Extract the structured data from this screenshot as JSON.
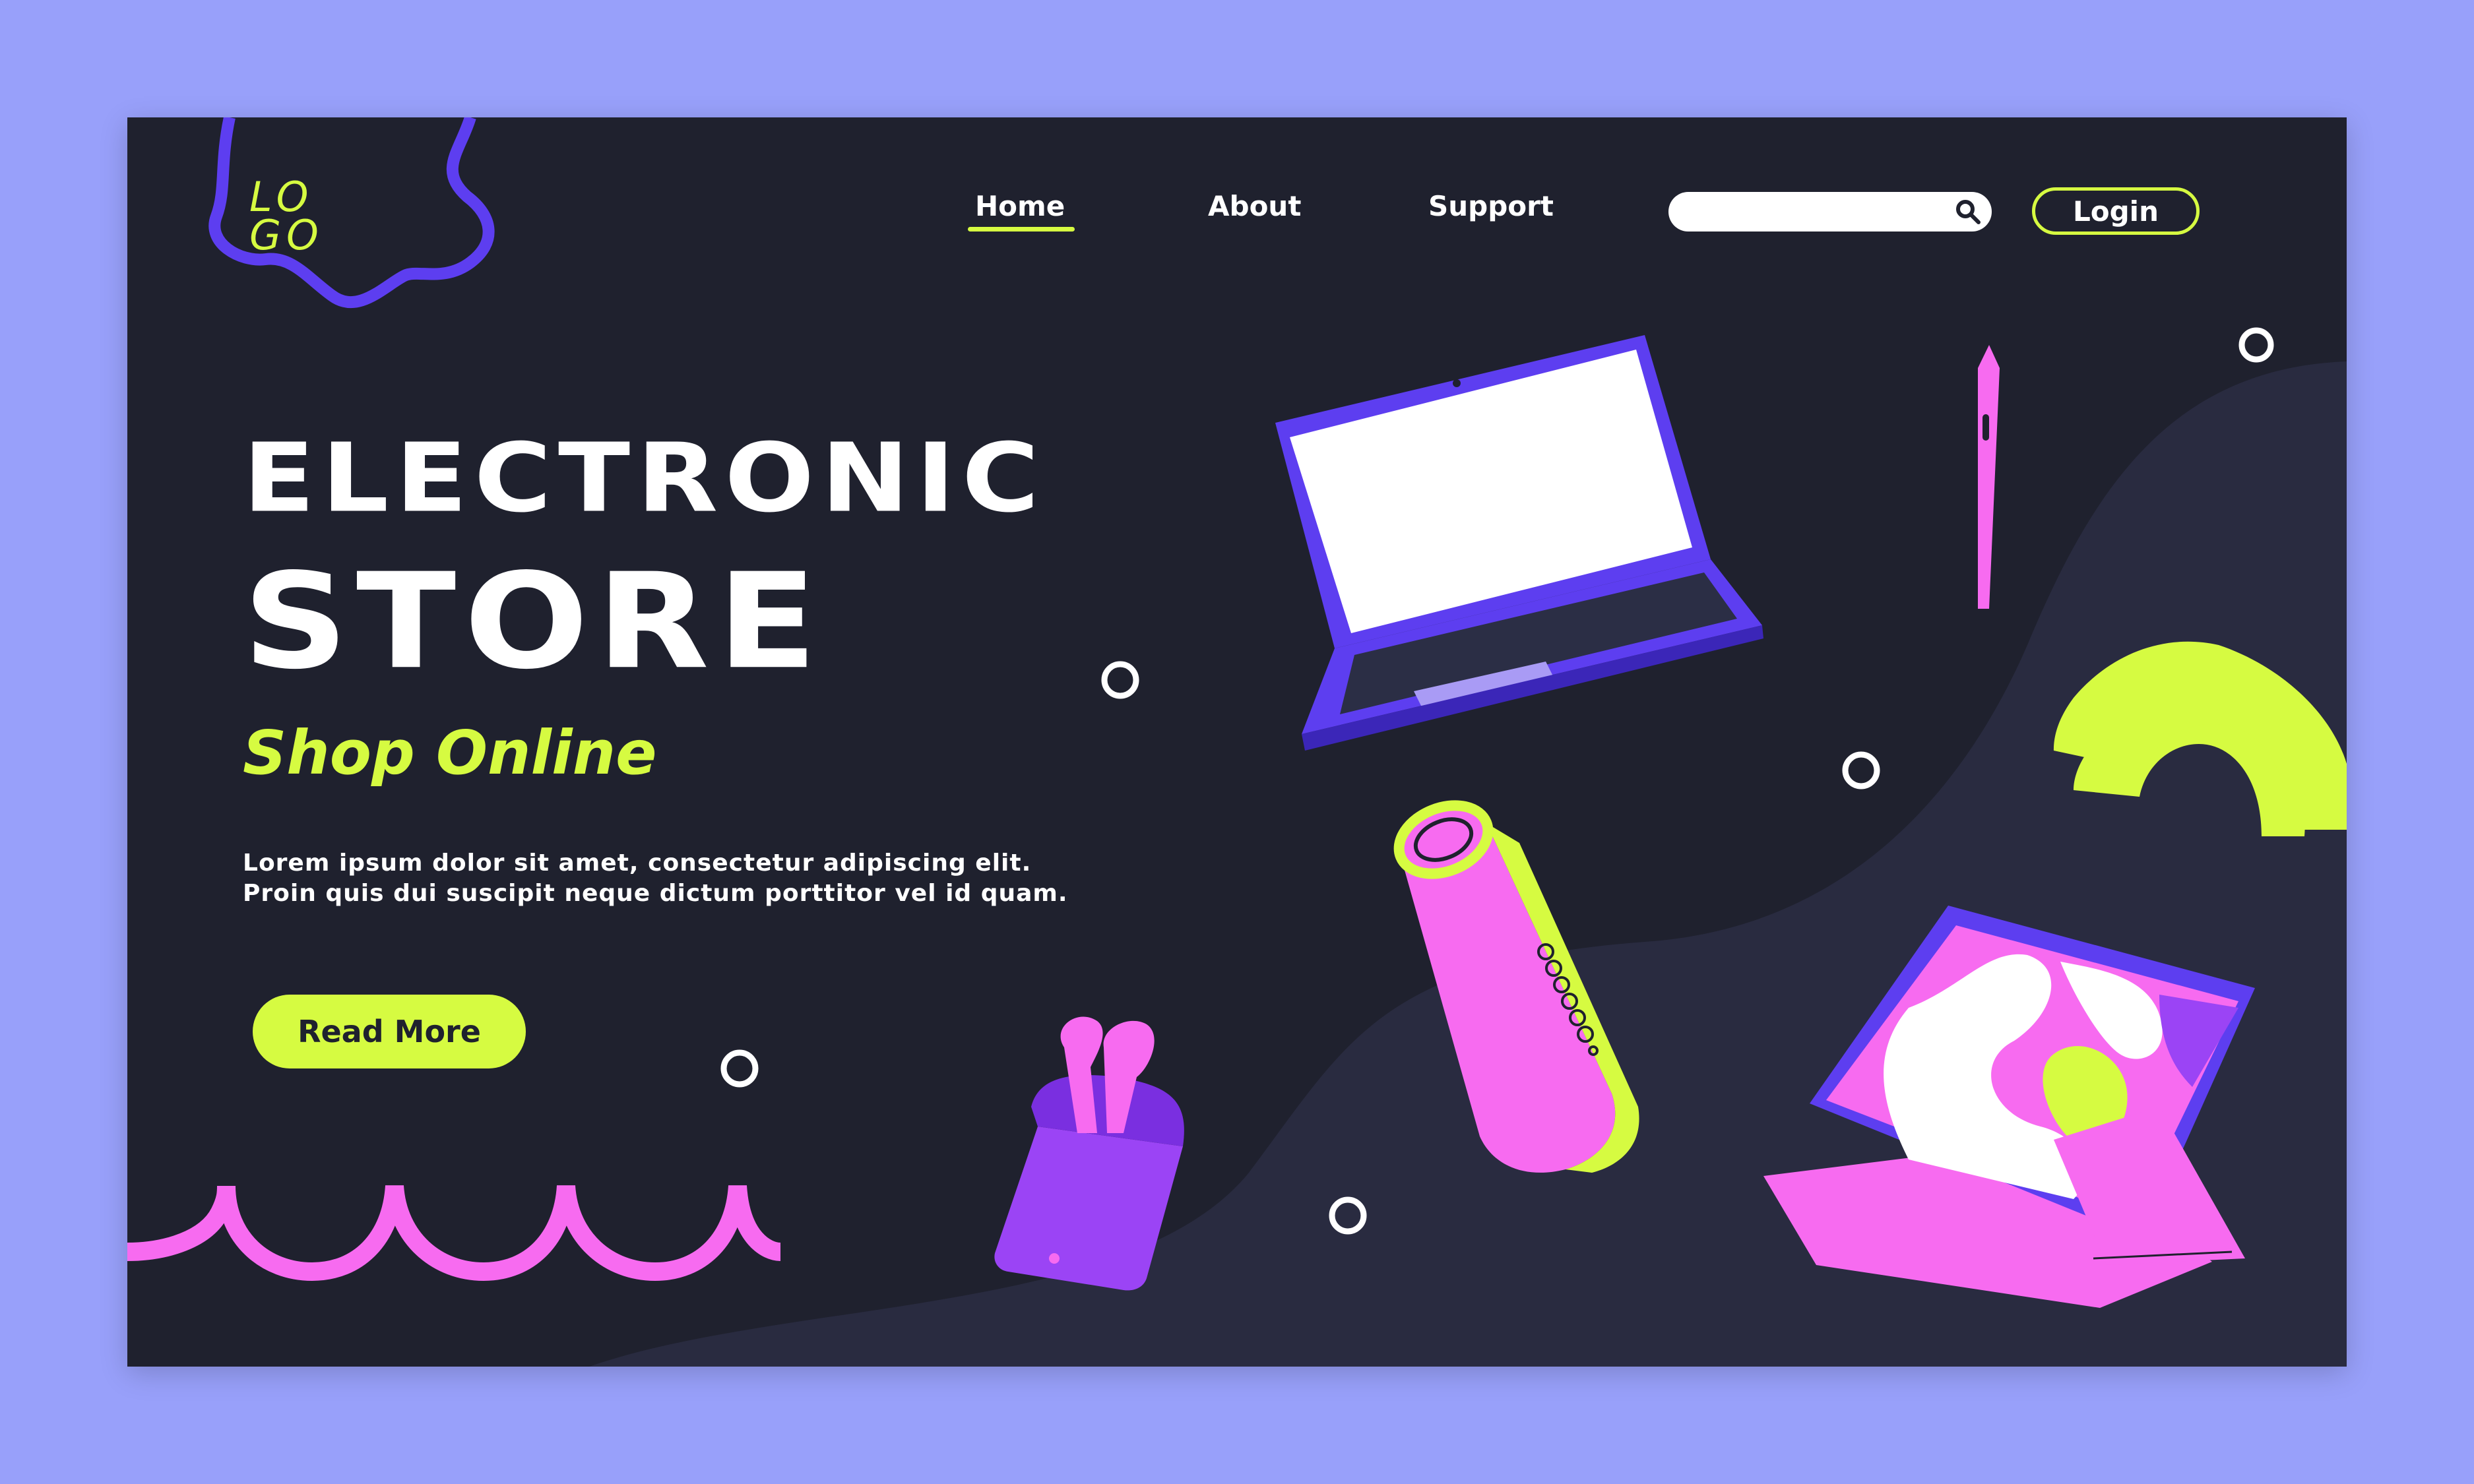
{
  "brand": {
    "logo_line1": "LO",
    "logo_line2": "GO"
  },
  "nav": {
    "home": "Home",
    "about": "About",
    "support": "Support",
    "active": "Home"
  },
  "search": {
    "placeholder": "",
    "value": ""
  },
  "login_label": "Login",
  "hero": {
    "title_line1": "ELECTRONIC",
    "title_line2": "STORE",
    "subtitle": "Shop Online",
    "body_line1": "Lorem ipsum dolor sit amet, consectetur adipiscing elit.",
    "body_line2": "Proin quis dui suscipit neque dictum porttitor vel id quam.",
    "cta_label": "Read More"
  },
  "colors": {
    "background": "#98a0fa",
    "page": "#1f212e",
    "accent_lime": "#d6fb41",
    "accent_pink": "#f76bf0",
    "accent_purple": "#5d3ef0",
    "text": "#ffffff"
  },
  "icons": [
    "search-icon",
    "laptop-illustration",
    "speaker-illustration",
    "earbuds-illustration",
    "tablet-illustration",
    "stylus-illustration"
  ]
}
